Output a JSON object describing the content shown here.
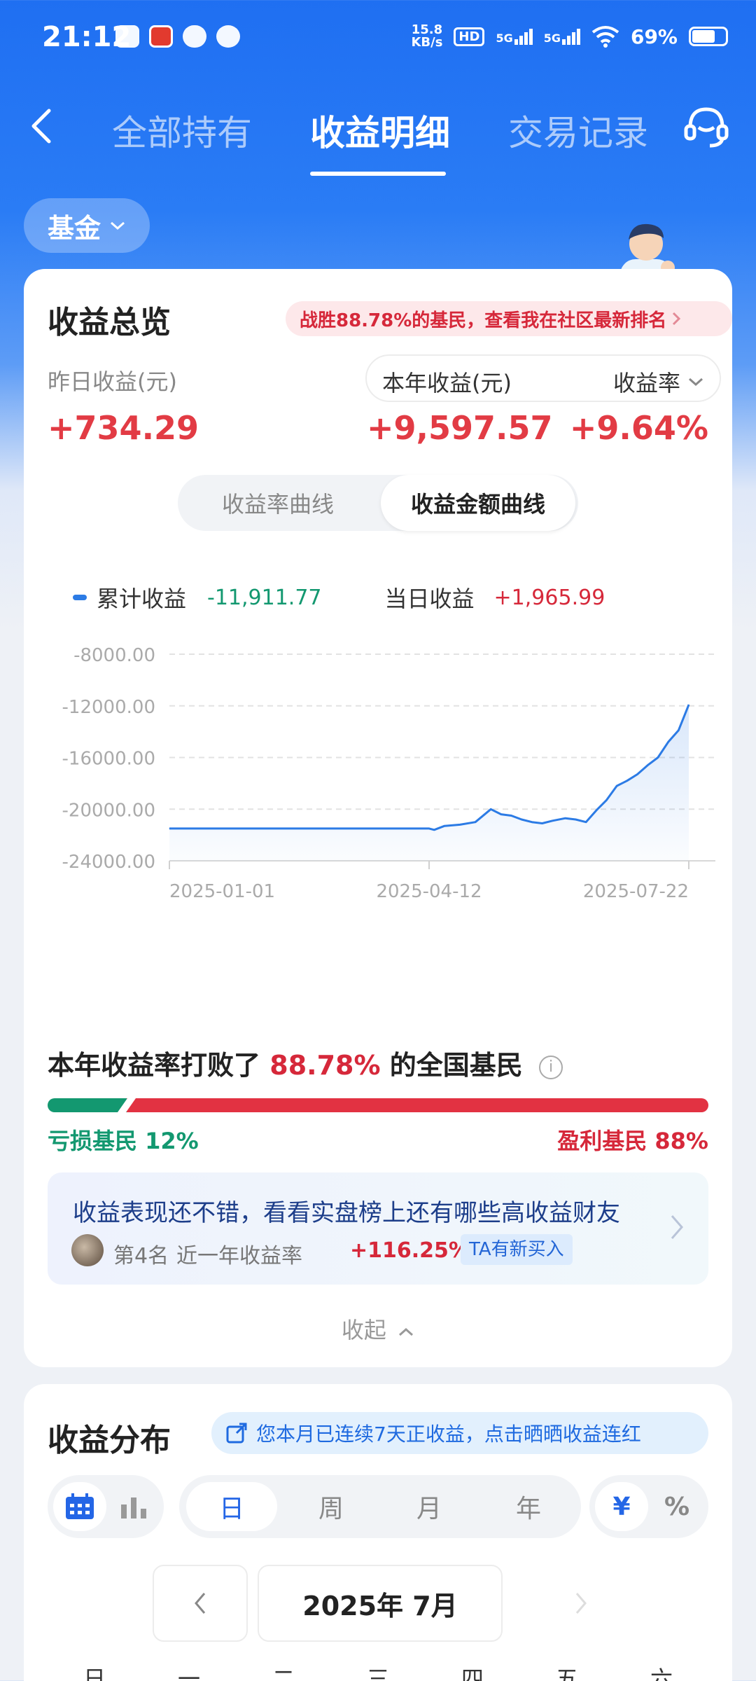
{
  "status": {
    "time": "21:12",
    "speed": "15.8\nKB/s",
    "hd": "HD",
    "net1": "5G",
    "net2": "5G",
    "battery": "69%"
  },
  "nav": {
    "tabs": [
      "全部持有",
      "收益明细",
      "交易记录"
    ],
    "active_tab": 1
  },
  "filter": {
    "fund": "基金"
  },
  "overview": {
    "title": "收益总览",
    "rank_banner": "战胜88.78%的基民，查看我在社区最新排名",
    "yesterday_label": "昨日收益(元)",
    "yesterday_value": "+734.29",
    "year_label": "本年收益(元)",
    "year_value": "+9,597.57",
    "rate_label": "收益率",
    "rate_value": "+9.64%",
    "curve_tabs": [
      "收益率曲线",
      "收益金额曲线"
    ],
    "curve_active": 1,
    "legend_cum_label": "累计收益",
    "legend_cum_value": "-11,911.77",
    "legend_day_label": "当日收益",
    "legend_day_value": "+1,965.99"
  },
  "chart_data": {
    "type": "area",
    "y_ticks": [
      "-8000.00",
      "-12000.00",
      "-16000.00",
      "-20000.00",
      "-24000.00"
    ],
    "x_ticks": [
      "2025-01-01",
      "2025-04-12",
      "2025-07-22"
    ],
    "ylim": [
      -24000,
      -8000
    ],
    "grid": true,
    "series": [
      {
        "points": [
          [
            "2025-01-01",
            -21500
          ],
          [
            "2025-02-01",
            -21500
          ],
          [
            "2025-03-01",
            -21500
          ],
          [
            "2025-04-01",
            -21500
          ],
          [
            "2025-04-12",
            -21500
          ],
          [
            "2025-04-14",
            -21600
          ],
          [
            "2025-04-18",
            -21300
          ],
          [
            "2025-04-24",
            -21200
          ],
          [
            "2025-04-30",
            -21000
          ],
          [
            "2025-05-06",
            -20000
          ],
          [
            "2025-05-10",
            -20400
          ],
          [
            "2025-05-14",
            -20500
          ],
          [
            "2025-05-18",
            -20800
          ],
          [
            "2025-05-22",
            -21000
          ],
          [
            "2025-05-26",
            -21100
          ],
          [
            "2025-05-30",
            -20900
          ],
          [
            "2025-06-04",
            -20700
          ],
          [
            "2025-06-08",
            -20800
          ],
          [
            "2025-06-12",
            -21000
          ],
          [
            "2025-06-16",
            -20100
          ],
          [
            "2025-06-20",
            -19300
          ],
          [
            "2025-06-24",
            -18200
          ],
          [
            "2025-06-28",
            -17800
          ],
          [
            "2025-07-02",
            -17300
          ],
          [
            "2025-07-06",
            -16600
          ],
          [
            "2025-07-10",
            -16000
          ],
          [
            "2025-07-14",
            -14800
          ],
          [
            "2025-07-18",
            -13900
          ],
          [
            "2025-07-22",
            -11912
          ]
        ]
      }
    ]
  },
  "beat": {
    "prefix": "本年收益率打败了",
    "pct": "88.78%",
    "suffix": "的全国基民",
    "info": "i",
    "loss_label": "亏损基民 12%",
    "gain_label": "盈利基民 88%",
    "loss_share": 0.12
  },
  "promo": {
    "text": "收益表现还不错，看看实盘榜上还有哪些高收益财友",
    "rank": "第4名",
    "rate_label": "近一年收益率",
    "rate_value": "+116.25%",
    "tag": "TA有新买入"
  },
  "collapse_label": "收起",
  "distribution": {
    "title": "收益分布",
    "streak": "您本月已连续7天正收益，点击晒晒收益连红",
    "period_tabs": [
      "日",
      "周",
      "月",
      "年"
    ],
    "unit_tabs": [
      "¥",
      "%"
    ],
    "month_label": "2025年 7月",
    "weekdays": [
      "日",
      "一",
      "二",
      "三",
      "四",
      "五",
      "六"
    ]
  }
}
